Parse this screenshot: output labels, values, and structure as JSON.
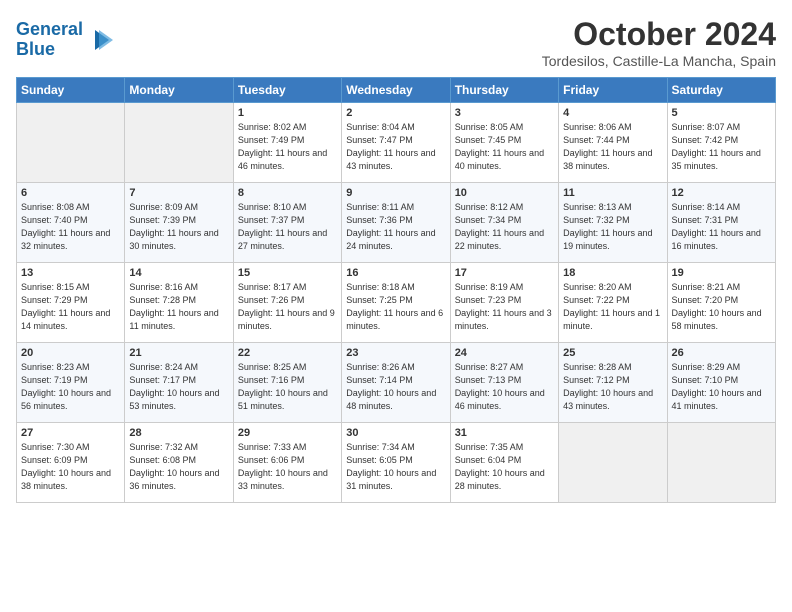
{
  "header": {
    "logo_line1": "General",
    "logo_line2": "Blue",
    "month": "October 2024",
    "location": "Tordesilos, Castille-La Mancha, Spain"
  },
  "weekdays": [
    "Sunday",
    "Monday",
    "Tuesday",
    "Wednesday",
    "Thursday",
    "Friday",
    "Saturday"
  ],
  "weeks": [
    [
      {
        "day": "",
        "info": ""
      },
      {
        "day": "",
        "info": ""
      },
      {
        "day": "1",
        "info": "Sunrise: 8:02 AM\nSunset: 7:49 PM\nDaylight: 11 hours and 46 minutes."
      },
      {
        "day": "2",
        "info": "Sunrise: 8:04 AM\nSunset: 7:47 PM\nDaylight: 11 hours and 43 minutes."
      },
      {
        "day": "3",
        "info": "Sunrise: 8:05 AM\nSunset: 7:45 PM\nDaylight: 11 hours and 40 minutes."
      },
      {
        "day": "4",
        "info": "Sunrise: 8:06 AM\nSunset: 7:44 PM\nDaylight: 11 hours and 38 minutes."
      },
      {
        "day": "5",
        "info": "Sunrise: 8:07 AM\nSunset: 7:42 PM\nDaylight: 11 hours and 35 minutes."
      }
    ],
    [
      {
        "day": "6",
        "info": "Sunrise: 8:08 AM\nSunset: 7:40 PM\nDaylight: 11 hours and 32 minutes."
      },
      {
        "day": "7",
        "info": "Sunrise: 8:09 AM\nSunset: 7:39 PM\nDaylight: 11 hours and 30 minutes."
      },
      {
        "day": "8",
        "info": "Sunrise: 8:10 AM\nSunset: 7:37 PM\nDaylight: 11 hours and 27 minutes."
      },
      {
        "day": "9",
        "info": "Sunrise: 8:11 AM\nSunset: 7:36 PM\nDaylight: 11 hours and 24 minutes."
      },
      {
        "day": "10",
        "info": "Sunrise: 8:12 AM\nSunset: 7:34 PM\nDaylight: 11 hours and 22 minutes."
      },
      {
        "day": "11",
        "info": "Sunrise: 8:13 AM\nSunset: 7:32 PM\nDaylight: 11 hours and 19 minutes."
      },
      {
        "day": "12",
        "info": "Sunrise: 8:14 AM\nSunset: 7:31 PM\nDaylight: 11 hours and 16 minutes."
      }
    ],
    [
      {
        "day": "13",
        "info": "Sunrise: 8:15 AM\nSunset: 7:29 PM\nDaylight: 11 hours and 14 minutes."
      },
      {
        "day": "14",
        "info": "Sunrise: 8:16 AM\nSunset: 7:28 PM\nDaylight: 11 hours and 11 minutes."
      },
      {
        "day": "15",
        "info": "Sunrise: 8:17 AM\nSunset: 7:26 PM\nDaylight: 11 hours and 9 minutes."
      },
      {
        "day": "16",
        "info": "Sunrise: 8:18 AM\nSunset: 7:25 PM\nDaylight: 11 hours and 6 minutes."
      },
      {
        "day": "17",
        "info": "Sunrise: 8:19 AM\nSunset: 7:23 PM\nDaylight: 11 hours and 3 minutes."
      },
      {
        "day": "18",
        "info": "Sunrise: 8:20 AM\nSunset: 7:22 PM\nDaylight: 11 hours and 1 minute."
      },
      {
        "day": "19",
        "info": "Sunrise: 8:21 AM\nSunset: 7:20 PM\nDaylight: 10 hours and 58 minutes."
      }
    ],
    [
      {
        "day": "20",
        "info": "Sunrise: 8:23 AM\nSunset: 7:19 PM\nDaylight: 10 hours and 56 minutes."
      },
      {
        "day": "21",
        "info": "Sunrise: 8:24 AM\nSunset: 7:17 PM\nDaylight: 10 hours and 53 minutes."
      },
      {
        "day": "22",
        "info": "Sunrise: 8:25 AM\nSunset: 7:16 PM\nDaylight: 10 hours and 51 minutes."
      },
      {
        "day": "23",
        "info": "Sunrise: 8:26 AM\nSunset: 7:14 PM\nDaylight: 10 hours and 48 minutes."
      },
      {
        "day": "24",
        "info": "Sunrise: 8:27 AM\nSunset: 7:13 PM\nDaylight: 10 hours and 46 minutes."
      },
      {
        "day": "25",
        "info": "Sunrise: 8:28 AM\nSunset: 7:12 PM\nDaylight: 10 hours and 43 minutes."
      },
      {
        "day": "26",
        "info": "Sunrise: 8:29 AM\nSunset: 7:10 PM\nDaylight: 10 hours and 41 minutes."
      }
    ],
    [
      {
        "day": "27",
        "info": "Sunrise: 7:30 AM\nSunset: 6:09 PM\nDaylight: 10 hours and 38 minutes."
      },
      {
        "day": "28",
        "info": "Sunrise: 7:32 AM\nSunset: 6:08 PM\nDaylight: 10 hours and 36 minutes."
      },
      {
        "day": "29",
        "info": "Sunrise: 7:33 AM\nSunset: 6:06 PM\nDaylight: 10 hours and 33 minutes."
      },
      {
        "day": "30",
        "info": "Sunrise: 7:34 AM\nSunset: 6:05 PM\nDaylight: 10 hours and 31 minutes."
      },
      {
        "day": "31",
        "info": "Sunrise: 7:35 AM\nSunset: 6:04 PM\nDaylight: 10 hours and 28 minutes."
      },
      {
        "day": "",
        "info": ""
      },
      {
        "day": "",
        "info": ""
      }
    ]
  ]
}
